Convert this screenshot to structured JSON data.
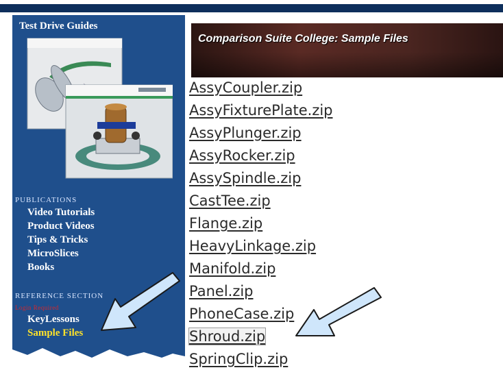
{
  "sidebar": {
    "title": "Test Drive Guides",
    "publications_heading": "Publications",
    "publications": [
      "Video Tutorials",
      "Product Videos",
      "Tips & Tricks",
      "MicroSlices",
      "Books"
    ],
    "reference_heading": "Reference Section",
    "login_required": "Login Required",
    "reference_links": [
      "KeyLessons",
      "Sample Files"
    ],
    "active_link": "Sample Files"
  },
  "banner": {
    "title": "Comparison Suite College: Sample Files"
  },
  "files": [
    "AssyCoupler.zip",
    "AssyFixturePlate.zip",
    "AssyPlunger.zip",
    "AssyRocker.zip",
    "AssySpindle.zip",
    "CastTee.zip",
    "Flange.zip",
    "HeavyLinkage.zip",
    "Manifold.zip",
    "Panel.zip",
    "PhoneCase.zip",
    "Shroud.zip",
    "SpringClip.zip"
  ],
  "highlighted_file": "Shroud.zip",
  "colors": {
    "sidebar": "#1f4f8c",
    "active_link": "#ffe32a",
    "login_required": "#d8262a",
    "arrow_fill": "#cfe6fb"
  },
  "icons": {
    "guide_images": "guide-covers-illustration",
    "arrows": "callout-arrow-icon"
  }
}
